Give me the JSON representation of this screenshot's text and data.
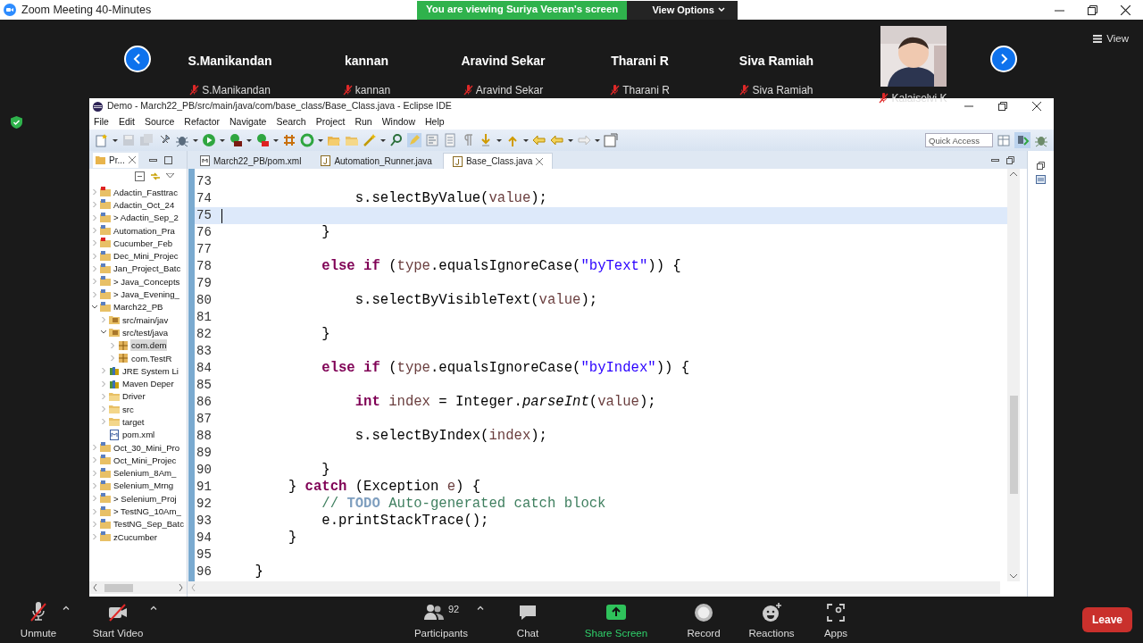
{
  "app": {
    "title": "Zoom Meeting 40-Minutes"
  },
  "share_banner": {
    "text": "You are viewing Suriya Veeran's screen",
    "menu": "View Options"
  },
  "participants": [
    {
      "kind": "name",
      "display": "S.Manikandan",
      "label": "S.Manikandan",
      "muted": true
    },
    {
      "kind": "name",
      "display": "kannan",
      "label": "kannan",
      "muted": true
    },
    {
      "kind": "name",
      "display": "Aravind Sekar",
      "label": "Aravind Sekar",
      "muted": true
    },
    {
      "kind": "name",
      "display": "Tharani R",
      "label": "Tharani R",
      "muted": true
    },
    {
      "kind": "name",
      "display": "Siva Ramiah",
      "label": "Siva Ramiah",
      "muted": true
    },
    {
      "kind": "video",
      "label": "Kalaiselvi K",
      "muted": true
    }
  ],
  "view_button": "View",
  "eclipse": {
    "title": "Demo - March22_PB/src/main/java/com/base_class/Base_Class.java - Eclipse IDE",
    "menu": [
      "File",
      "Edit",
      "Source",
      "Refactor",
      "Navigate",
      "Search",
      "Project",
      "Run",
      "Window",
      "Help"
    ],
    "quick_access": {
      "placeholder": "Quick Access"
    },
    "explorer": {
      "tab": "Pr...",
      "tree": [
        {
          "label": "Adactin_Fasttrac",
          "kind": "project-error",
          "expanded": false,
          "selected": false
        },
        {
          "label": "Adactin_Oct_24",
          "kind": "project",
          "expanded": false,
          "selected": false
        },
        {
          "label": "> Adactin_Sep_2",
          "kind": "project",
          "expanded": false,
          "selected": false
        },
        {
          "label": "Automation_Pra",
          "kind": "project",
          "expanded": false,
          "selected": false
        },
        {
          "label": "Cucumber_Feb",
          "kind": "project-error",
          "expanded": false,
          "selected": false
        },
        {
          "label": "Dec_Mini_Projec",
          "kind": "project",
          "expanded": false,
          "selected": false
        },
        {
          "label": "Jan_Project_Batc",
          "kind": "project",
          "expanded": false,
          "selected": false
        },
        {
          "label": "> Java_Concepts",
          "kind": "project",
          "expanded": false,
          "selected": false
        },
        {
          "label": "> Java_Evening_",
          "kind": "project",
          "expanded": false,
          "selected": false
        },
        {
          "label": "March22_PB",
          "kind": "project",
          "expanded": true,
          "selected": false,
          "children": [
            {
              "label": "src/main/jav",
              "kind": "source-folder",
              "expanded": false,
              "selected": false
            },
            {
              "label": "src/test/java",
              "kind": "source-folder",
              "expanded": true,
              "selected": false,
              "children": [
                {
                  "label": "com.dem",
                  "kind": "package",
                  "expanded": false,
                  "selected": true
                },
                {
                  "label": "com.TestR",
                  "kind": "package",
                  "expanded": false,
                  "selected": false
                }
              ]
            },
            {
              "label": "JRE System Li",
              "kind": "library",
              "expanded": false,
              "selected": false
            },
            {
              "label": "Maven Deper",
              "kind": "library",
              "expanded": false,
              "selected": false
            },
            {
              "label": "Driver",
              "kind": "folder",
              "expanded": false,
              "selected": false
            },
            {
              "label": "src",
              "kind": "folder",
              "expanded": false,
              "selected": false
            },
            {
              "label": "target",
              "kind": "folder",
              "expanded": false,
              "selected": false
            },
            {
              "label": "pom.xml",
              "kind": "file",
              "selected": false
            }
          ]
        },
        {
          "label": "Oct_30_Mini_Pro",
          "kind": "project",
          "expanded": false,
          "selected": false
        },
        {
          "label": "Oct_Mini_Projec",
          "kind": "project",
          "expanded": false,
          "selected": false
        },
        {
          "label": "Selenium_8Am_",
          "kind": "project",
          "expanded": false,
          "selected": false
        },
        {
          "label": "Selenium_Mrng",
          "kind": "project",
          "expanded": false,
          "selected": false
        },
        {
          "label": "> Selenium_Proj",
          "kind": "project",
          "expanded": false,
          "selected": false
        },
        {
          "label": "> TestNG_10Am_",
          "kind": "project",
          "expanded": false,
          "selected": false
        },
        {
          "label": "TestNG_Sep_Batc",
          "kind": "project",
          "expanded": false,
          "selected": false
        },
        {
          "label": "zCucumber",
          "kind": "project",
          "expanded": false,
          "selected": false
        }
      ]
    },
    "editor": {
      "tabs": [
        {
          "label": "March22_PB/pom.xml",
          "kind": "maven",
          "selected": false
        },
        {
          "label": "Automation_Runner.java",
          "kind": "java",
          "selected": false
        },
        {
          "label": "Base_Class.java",
          "kind": "java",
          "selected": true
        }
      ],
      "lines": [
        {
          "number": "73",
          "current": false
        },
        {
          "number": "74",
          "current": false,
          "tokens": [
            {
              "kind": "plain",
              "text": "                s.selectByValue("
            },
            {
              "kind": "local",
              "text": "value"
            },
            {
              "kind": "plain",
              "text": ");"
            }
          ]
        },
        {
          "number": "75",
          "current": true
        },
        {
          "number": "76",
          "current": false,
          "tokens": [
            {
              "kind": "plain",
              "text": "            }"
            }
          ]
        },
        {
          "number": "77",
          "current": false
        },
        {
          "number": "78",
          "current": false,
          "tokens": [
            {
              "kind": "keyword",
              "text": "            else if"
            },
            {
              "kind": "plain",
              "text": " ("
            },
            {
              "kind": "local",
              "text": "type"
            },
            {
              "kind": "plain",
              "text": ".equalsIgnoreCase("
            },
            {
              "kind": "string",
              "text": "\"byText\""
            },
            {
              "kind": "plain",
              "text": ")) {"
            }
          ]
        },
        {
          "number": "79",
          "current": false
        },
        {
          "number": "80",
          "current": false,
          "tokens": [
            {
              "kind": "plain",
              "text": "                s.selectByVisibleText("
            },
            {
              "kind": "local",
              "text": "value"
            },
            {
              "kind": "plain",
              "text": ");"
            }
          ]
        },
        {
          "number": "81",
          "current": false
        },
        {
          "number": "82",
          "current": false,
          "tokens": [
            {
              "kind": "plain",
              "text": "            }"
            }
          ]
        },
        {
          "number": "83",
          "current": false
        },
        {
          "number": "84",
          "current": false,
          "tokens": [
            {
              "kind": "keyword",
              "text": "            else if"
            },
            {
              "kind": "plain",
              "text": " ("
            },
            {
              "kind": "local",
              "text": "type"
            },
            {
              "kind": "plain",
              "text": ".equalsIgnoreCase("
            },
            {
              "kind": "string",
              "text": "\"byIndex\""
            },
            {
              "kind": "plain",
              "text": ")) {"
            }
          ]
        },
        {
          "number": "85",
          "current": false
        },
        {
          "number": "86",
          "current": false,
          "tokens": [
            {
              "kind": "keyword",
              "text": "                int"
            },
            {
              "kind": "local",
              "text": " index"
            },
            {
              "kind": "plain",
              "text": " = Integer."
            },
            {
              "kind": "static",
              "text": "parseInt"
            },
            {
              "kind": "plain",
              "text": "("
            },
            {
              "kind": "local",
              "text": "value"
            },
            {
              "kind": "plain",
              "text": ");"
            }
          ]
        },
        {
          "number": "87",
          "current": false
        },
        {
          "number": "88",
          "current": false,
          "tokens": [
            {
              "kind": "plain",
              "text": "                s.selectByIndex("
            },
            {
              "kind": "local",
              "text": "index"
            },
            {
              "kind": "plain",
              "text": ");"
            }
          ]
        },
        {
          "number": "89",
          "current": false
        },
        {
          "number": "90",
          "current": false,
          "tokens": [
            {
              "kind": "plain",
              "text": "            }"
            }
          ]
        },
        {
          "number": "91",
          "current": false,
          "tokens": [
            {
              "kind": "plain",
              "text": "        } "
            },
            {
              "kind": "keyword",
              "text": "catch"
            },
            {
              "kind": "plain",
              "text": " (Exception "
            },
            {
              "kind": "local",
              "text": "e"
            },
            {
              "kind": "plain",
              "text": ") {"
            }
          ]
        },
        {
          "number": "92",
          "current": false,
          "tokens": [
            {
              "kind": "comment",
              "text": "            // "
            },
            {
              "kind": "task",
              "text": "TODO"
            },
            {
              "kind": "comment",
              "text": " Auto-generated catch block"
            }
          ]
        },
        {
          "number": "93",
          "current": false,
          "tokens": [
            {
              "kind": "plain",
              "text": "            e.printStackTrace();"
            }
          ]
        },
        {
          "number": "94",
          "current": false,
          "tokens": [
            {
              "kind": "plain",
              "text": "        }"
            }
          ]
        },
        {
          "number": "95",
          "current": false
        },
        {
          "number": "96",
          "current": false,
          "tokens": [
            {
              "kind": "plain",
              "text": "    }"
            }
          ]
        }
      ]
    }
  },
  "toolbar": [
    {
      "kind": "mic",
      "label": "Unmute",
      "caret": true
    },
    {
      "kind": "video",
      "label": "Start Video",
      "caret": true
    },
    {
      "kind": "participants",
      "label": "Participants",
      "count": "92",
      "caret": true
    },
    {
      "kind": "chat",
      "label": "Chat",
      "caret": false
    },
    {
      "kind": "share",
      "label": "Share Screen",
      "caret": false
    },
    {
      "kind": "record",
      "label": "Record",
      "caret": false
    },
    {
      "kind": "reactions",
      "label": "Reactions",
      "caret": false
    },
    {
      "kind": "apps",
      "label": "Apps",
      "caret": false
    }
  ],
  "leave": "Leave"
}
